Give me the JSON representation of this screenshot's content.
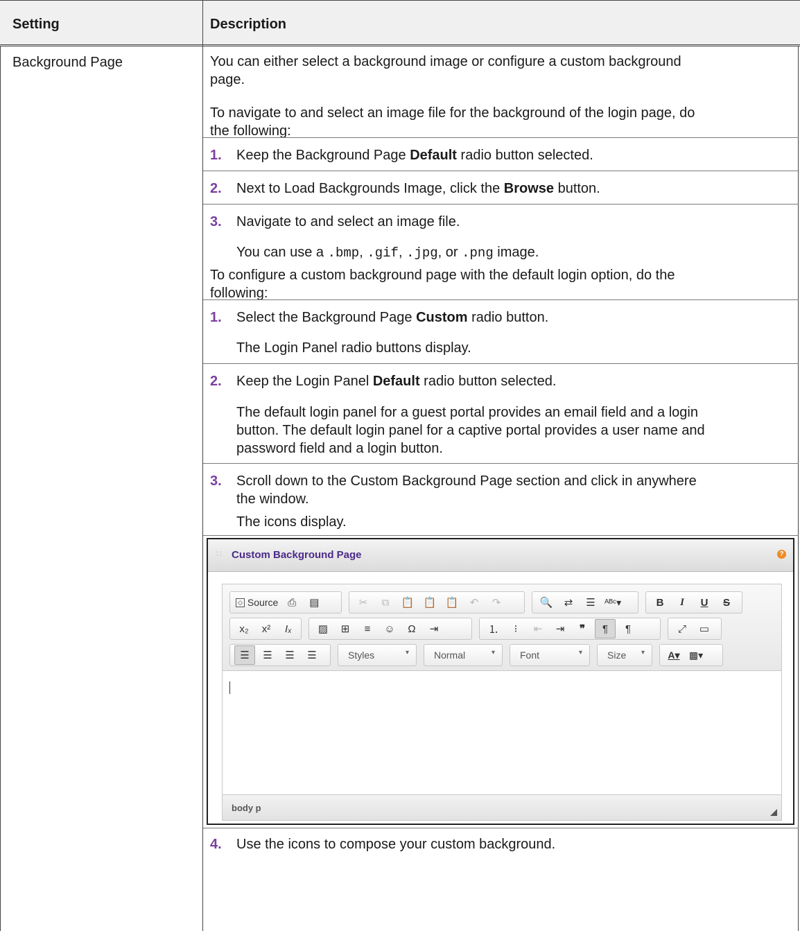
{
  "table": {
    "header": {
      "setting": "Setting",
      "description": "Description"
    },
    "row": {
      "setting": "Background Page",
      "intro_line1": "You can either select a background image or configure a custom background",
      "intro_line2": "page.",
      "image_intro_line1": "To navigate to and select an image file for the background of the login page, do",
      "image_intro_line2": "the following:",
      "image_steps": [
        {
          "num": "1.",
          "pre": "Keep the Background Page ",
          "bold": "Default",
          "post": " radio button selected."
        },
        {
          "num": "2.",
          "pre": "Next to Load Backgrounds Image, click the ",
          "bold": "Browse",
          "post": " button."
        },
        {
          "num": "3.",
          "pre": "Navigate to and select an image file.",
          "bold": "",
          "post": ""
        }
      ],
      "formats": {
        "pre": "You can use a ",
        "f1": ".bmp",
        "sep1": ", ",
        "f2": ".gif",
        "sep2": ", ",
        "f3": ".jpg",
        "sep3": ", or ",
        "f4": ".png",
        "post": " image."
      },
      "custom_intro_line1": "To configure a custom background page with the default login option, do the",
      "custom_intro_line2": "following:",
      "custom_steps": [
        {
          "num": "1.",
          "pre": "Select the Background Page ",
          "bold": "Custom",
          "post": " radio button."
        },
        {
          "num": "2.",
          "pre": "Keep the Login Panel ",
          "bold": "Default",
          "post": " radio button selected."
        },
        {
          "num": "3.",
          "text_line1": "Scroll down to the Custom Background Page section and click in anywhere",
          "text_line2": "the window."
        },
        {
          "num": "4.",
          "text": "Use the icons to compose your custom background."
        }
      ],
      "custom_step1_note": "The Login Panel radio buttons display.",
      "custom_step2_note_lines": [
        "The default login panel for a guest portal provides an email field and a login",
        "button. The default login panel for a captive portal provides a user name and",
        "password field and a login button."
      ],
      "custom_step3_note": "The icons display."
    }
  },
  "editor": {
    "title": "Custom Background Page",
    "help_glyph": "?",
    "toolbar": {
      "source_label": "Source",
      "styles": "Styles",
      "format": "Normal",
      "font": "Font",
      "size": "Size",
      "bold": "B",
      "italic": "I",
      "underline": "U",
      "strike": "S"
    },
    "status_path": "body  p"
  }
}
